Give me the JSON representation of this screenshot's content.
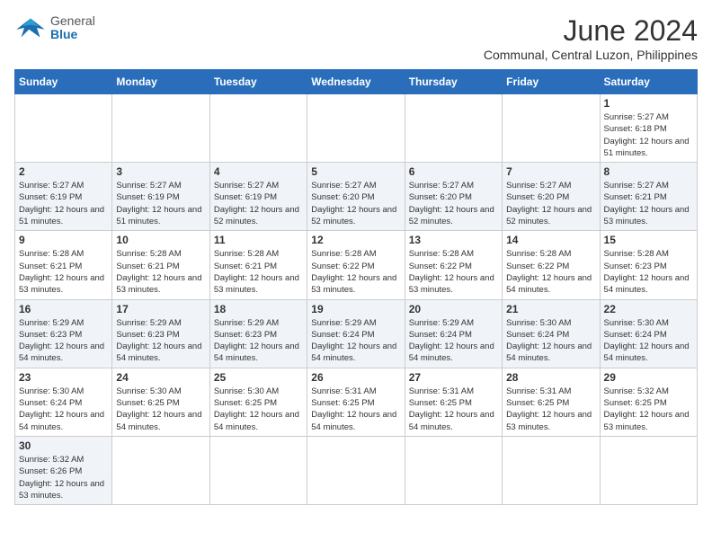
{
  "header": {
    "logo_general": "General",
    "logo_blue": "Blue",
    "month_title": "June 2024",
    "subtitle": "Communal, Central Luzon, Philippines"
  },
  "days_of_week": [
    "Sunday",
    "Monday",
    "Tuesday",
    "Wednesday",
    "Thursday",
    "Friday",
    "Saturday"
  ],
  "weeks": [
    [
      null,
      null,
      null,
      null,
      null,
      null,
      {
        "day": "1",
        "sunrise": "5:27 AM",
        "sunset": "6:18 PM",
        "daylight": "12 hours and 51 minutes."
      }
    ],
    [
      {
        "day": "2",
        "sunrise": "5:27 AM",
        "sunset": "6:19 PM",
        "daylight": "12 hours and 51 minutes."
      },
      {
        "day": "3",
        "sunrise": "5:27 AM",
        "sunset": "6:19 PM",
        "daylight": "12 hours and 51 minutes."
      },
      {
        "day": "4",
        "sunrise": "5:27 AM",
        "sunset": "6:19 PM",
        "daylight": "12 hours and 52 minutes."
      },
      {
        "day": "5",
        "sunrise": "5:27 AM",
        "sunset": "6:20 PM",
        "daylight": "12 hours and 52 minutes."
      },
      {
        "day": "6",
        "sunrise": "5:27 AM",
        "sunset": "6:20 PM",
        "daylight": "12 hours and 52 minutes."
      },
      {
        "day": "7",
        "sunrise": "5:27 AM",
        "sunset": "6:20 PM",
        "daylight": "12 hours and 52 minutes."
      },
      {
        "day": "8",
        "sunrise": "5:27 AM",
        "sunset": "6:21 PM",
        "daylight": "12 hours and 53 minutes."
      }
    ],
    [
      {
        "day": "9",
        "sunrise": "5:28 AM",
        "sunset": "6:21 PM",
        "daylight": "12 hours and 53 minutes."
      },
      {
        "day": "10",
        "sunrise": "5:28 AM",
        "sunset": "6:21 PM",
        "daylight": "12 hours and 53 minutes."
      },
      {
        "day": "11",
        "sunrise": "5:28 AM",
        "sunset": "6:21 PM",
        "daylight": "12 hours and 53 minutes."
      },
      {
        "day": "12",
        "sunrise": "5:28 AM",
        "sunset": "6:22 PM",
        "daylight": "12 hours and 53 minutes."
      },
      {
        "day": "13",
        "sunrise": "5:28 AM",
        "sunset": "6:22 PM",
        "daylight": "12 hours and 53 minutes."
      },
      {
        "day": "14",
        "sunrise": "5:28 AM",
        "sunset": "6:22 PM",
        "daylight": "12 hours and 54 minutes."
      },
      {
        "day": "15",
        "sunrise": "5:28 AM",
        "sunset": "6:23 PM",
        "daylight": "12 hours and 54 minutes."
      }
    ],
    [
      {
        "day": "16",
        "sunrise": "5:29 AM",
        "sunset": "6:23 PM",
        "daylight": "12 hours and 54 minutes."
      },
      {
        "day": "17",
        "sunrise": "5:29 AM",
        "sunset": "6:23 PM",
        "daylight": "12 hours and 54 minutes."
      },
      {
        "day": "18",
        "sunrise": "5:29 AM",
        "sunset": "6:23 PM",
        "daylight": "12 hours and 54 minutes."
      },
      {
        "day": "19",
        "sunrise": "5:29 AM",
        "sunset": "6:24 PM",
        "daylight": "12 hours and 54 minutes."
      },
      {
        "day": "20",
        "sunrise": "5:29 AM",
        "sunset": "6:24 PM",
        "daylight": "12 hours and 54 minutes."
      },
      {
        "day": "21",
        "sunrise": "5:30 AM",
        "sunset": "6:24 PM",
        "daylight": "12 hours and 54 minutes."
      },
      {
        "day": "22",
        "sunrise": "5:30 AM",
        "sunset": "6:24 PM",
        "daylight": "12 hours and 54 minutes."
      }
    ],
    [
      {
        "day": "23",
        "sunrise": "5:30 AM",
        "sunset": "6:24 PM",
        "daylight": "12 hours and 54 minutes."
      },
      {
        "day": "24",
        "sunrise": "5:30 AM",
        "sunset": "6:25 PM",
        "daylight": "12 hours and 54 minutes."
      },
      {
        "day": "25",
        "sunrise": "5:30 AM",
        "sunset": "6:25 PM",
        "daylight": "12 hours and 54 minutes."
      },
      {
        "day": "26",
        "sunrise": "5:31 AM",
        "sunset": "6:25 PM",
        "daylight": "12 hours and 54 minutes."
      },
      {
        "day": "27",
        "sunrise": "5:31 AM",
        "sunset": "6:25 PM",
        "daylight": "12 hours and 54 minutes."
      },
      {
        "day": "28",
        "sunrise": "5:31 AM",
        "sunset": "6:25 PM",
        "daylight": "12 hours and 53 minutes."
      },
      {
        "day": "29",
        "sunrise": "5:32 AM",
        "sunset": "6:25 PM",
        "daylight": "12 hours and 53 minutes."
      }
    ],
    [
      {
        "day": "30",
        "sunrise": "5:32 AM",
        "sunset": "6:26 PM",
        "daylight": "12 hours and 53 minutes."
      },
      null,
      null,
      null,
      null,
      null,
      null
    ]
  ],
  "labels": {
    "sunrise": "Sunrise:",
    "sunset": "Sunset:",
    "daylight": "Daylight:"
  }
}
